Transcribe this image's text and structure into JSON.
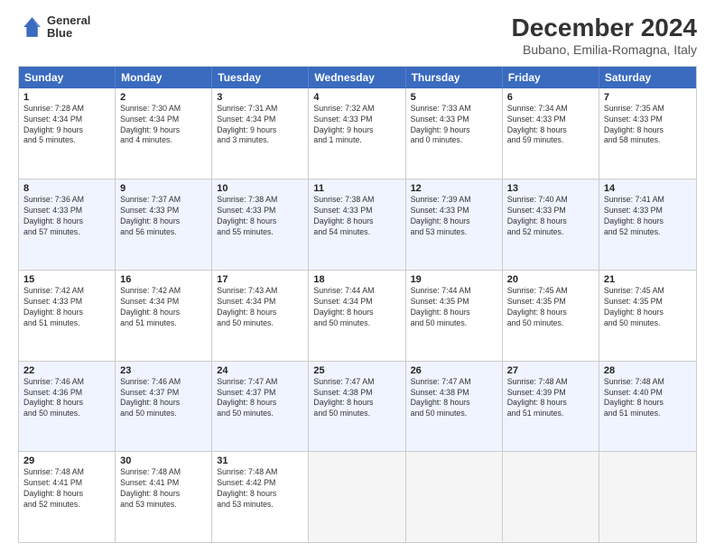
{
  "header": {
    "logo_line1": "General",
    "logo_line2": "Blue",
    "title": "December 2024",
    "subtitle": "Bubano, Emilia-Romagna, Italy"
  },
  "calendar": {
    "days": [
      "Sunday",
      "Monday",
      "Tuesday",
      "Wednesday",
      "Thursday",
      "Friday",
      "Saturday"
    ],
    "weeks": [
      [
        {
          "day": "",
          "info": ""
        },
        {
          "day": "2",
          "info": "Sunrise: 7:30 AM\nSunset: 4:34 PM\nDaylight: 9 hours\nand 4 minutes."
        },
        {
          "day": "3",
          "info": "Sunrise: 7:31 AM\nSunset: 4:34 PM\nDaylight: 9 hours\nand 3 minutes."
        },
        {
          "day": "4",
          "info": "Sunrise: 7:32 AM\nSunset: 4:33 PM\nDaylight: 9 hours\nand 1 minute."
        },
        {
          "day": "5",
          "info": "Sunrise: 7:33 AM\nSunset: 4:33 PM\nDaylight: 9 hours\nand 0 minutes."
        },
        {
          "day": "6",
          "info": "Sunrise: 7:34 AM\nSunset: 4:33 PM\nDaylight: 8 hours\nand 59 minutes."
        },
        {
          "day": "7",
          "info": "Sunrise: 7:35 AM\nSunset: 4:33 PM\nDaylight: 8 hours\nand 58 minutes."
        }
      ],
      [
        {
          "day": "8",
          "info": "Sunrise: 7:36 AM\nSunset: 4:33 PM\nDaylight: 8 hours\nand 57 minutes."
        },
        {
          "day": "9",
          "info": "Sunrise: 7:37 AM\nSunset: 4:33 PM\nDaylight: 8 hours\nand 56 minutes."
        },
        {
          "day": "10",
          "info": "Sunrise: 7:38 AM\nSunset: 4:33 PM\nDaylight: 8 hours\nand 55 minutes."
        },
        {
          "day": "11",
          "info": "Sunrise: 7:38 AM\nSunset: 4:33 PM\nDaylight: 8 hours\nand 54 minutes."
        },
        {
          "day": "12",
          "info": "Sunrise: 7:39 AM\nSunset: 4:33 PM\nDaylight: 8 hours\nand 53 minutes."
        },
        {
          "day": "13",
          "info": "Sunrise: 7:40 AM\nSunset: 4:33 PM\nDaylight: 8 hours\nand 52 minutes."
        },
        {
          "day": "14",
          "info": "Sunrise: 7:41 AM\nSunset: 4:33 PM\nDaylight: 8 hours\nand 52 minutes."
        }
      ],
      [
        {
          "day": "15",
          "info": "Sunrise: 7:42 AM\nSunset: 4:33 PM\nDaylight: 8 hours\nand 51 minutes."
        },
        {
          "day": "16",
          "info": "Sunrise: 7:42 AM\nSunset: 4:34 PM\nDaylight: 8 hours\nand 51 minutes."
        },
        {
          "day": "17",
          "info": "Sunrise: 7:43 AM\nSunset: 4:34 PM\nDaylight: 8 hours\nand 50 minutes."
        },
        {
          "day": "18",
          "info": "Sunrise: 7:44 AM\nSunset: 4:34 PM\nDaylight: 8 hours\nand 50 minutes."
        },
        {
          "day": "19",
          "info": "Sunrise: 7:44 AM\nSunset: 4:35 PM\nDaylight: 8 hours\nand 50 minutes."
        },
        {
          "day": "20",
          "info": "Sunrise: 7:45 AM\nSunset: 4:35 PM\nDaylight: 8 hours\nand 50 minutes."
        },
        {
          "day": "21",
          "info": "Sunrise: 7:45 AM\nSunset: 4:35 PM\nDaylight: 8 hours\nand 50 minutes."
        }
      ],
      [
        {
          "day": "22",
          "info": "Sunrise: 7:46 AM\nSunset: 4:36 PM\nDaylight: 8 hours\nand 50 minutes."
        },
        {
          "day": "23",
          "info": "Sunrise: 7:46 AM\nSunset: 4:37 PM\nDaylight: 8 hours\nand 50 minutes."
        },
        {
          "day": "24",
          "info": "Sunrise: 7:47 AM\nSunset: 4:37 PM\nDaylight: 8 hours\nand 50 minutes."
        },
        {
          "day": "25",
          "info": "Sunrise: 7:47 AM\nSunset: 4:38 PM\nDaylight: 8 hours\nand 50 minutes."
        },
        {
          "day": "26",
          "info": "Sunrise: 7:47 AM\nSunset: 4:38 PM\nDaylight: 8 hours\nand 50 minutes."
        },
        {
          "day": "27",
          "info": "Sunrise: 7:48 AM\nSunset: 4:39 PM\nDaylight: 8 hours\nand 51 minutes."
        },
        {
          "day": "28",
          "info": "Sunrise: 7:48 AM\nSunset: 4:40 PM\nDaylight: 8 hours\nand 51 minutes."
        }
      ],
      [
        {
          "day": "29",
          "info": "Sunrise: 7:48 AM\nSunset: 4:41 PM\nDaylight: 8 hours\nand 52 minutes."
        },
        {
          "day": "30",
          "info": "Sunrise: 7:48 AM\nSunset: 4:41 PM\nDaylight: 8 hours\nand 53 minutes."
        },
        {
          "day": "31",
          "info": "Sunrise: 7:48 AM\nSunset: 4:42 PM\nDaylight: 8 hours\nand 53 minutes."
        },
        {
          "day": "",
          "info": ""
        },
        {
          "day": "",
          "info": ""
        },
        {
          "day": "",
          "info": ""
        },
        {
          "day": "",
          "info": ""
        }
      ]
    ],
    "week1_day1": {
      "day": "1",
      "info": "Sunrise: 7:28 AM\nSunset: 4:34 PM\nDaylight: 9 hours\nand 5 minutes."
    }
  }
}
